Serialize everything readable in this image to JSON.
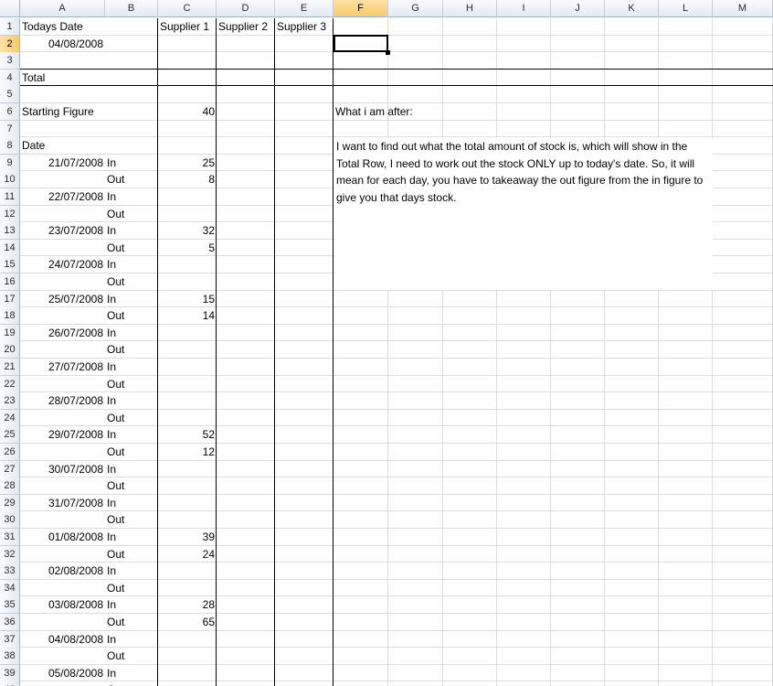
{
  "columns": [
    "A",
    "B",
    "C",
    "D",
    "E",
    "F",
    "G",
    "H",
    "I",
    "J",
    "K",
    "L",
    "M"
  ],
  "selected_column": "F",
  "selected_row": 2,
  "header": {
    "todays_date_label": "Todays Date",
    "todays_date_value": "04/08/2008",
    "supplier1": "Supplier 1",
    "supplier2": "Supplier 2",
    "supplier3": "Supplier 3",
    "total_label": "Total",
    "starting_figure_label": "Starting Figure",
    "starting_figure_value": "40",
    "date_label": "Date"
  },
  "note": {
    "title": "What i am after:",
    "body": "I want to find out what the total amount of stock is, which will show in the Total Row, I need to work out the stock ONLY up to today's date. So, it will mean for each day, you have to takeaway the out figure from the in figure to give you that days stock."
  },
  "entries": [
    {
      "date": "21/07/2008",
      "in": "25",
      "out": "8"
    },
    {
      "date": "22/07/2008",
      "in": "",
      "out": ""
    },
    {
      "date": "23/07/2008",
      "in": "32",
      "out": "5"
    },
    {
      "date": "24/07/2008",
      "in": "",
      "out": ""
    },
    {
      "date": "25/07/2008",
      "in": "15",
      "out": "14"
    },
    {
      "date": "26/07/2008",
      "in": "",
      "out": ""
    },
    {
      "date": "27/07/2008",
      "in": "",
      "out": ""
    },
    {
      "date": "28/07/2008",
      "in": "",
      "out": ""
    },
    {
      "date": "29/07/2008",
      "in": "52",
      "out": "12"
    },
    {
      "date": "30/07/2008",
      "in": "",
      "out": ""
    },
    {
      "date": "31/07/2008",
      "in": "",
      "out": ""
    },
    {
      "date": "01/08/2008",
      "in": "39",
      "out": "24"
    },
    {
      "date": "02/08/2008",
      "in": "",
      "out": ""
    },
    {
      "date": "03/08/2008",
      "in": "28",
      "out": "65"
    },
    {
      "date": "04/08/2008",
      "in": "",
      "out": ""
    },
    {
      "date": "05/08/2008",
      "in": "",
      "out": ""
    }
  ],
  "labels": {
    "in": "In",
    "out": "Out"
  }
}
